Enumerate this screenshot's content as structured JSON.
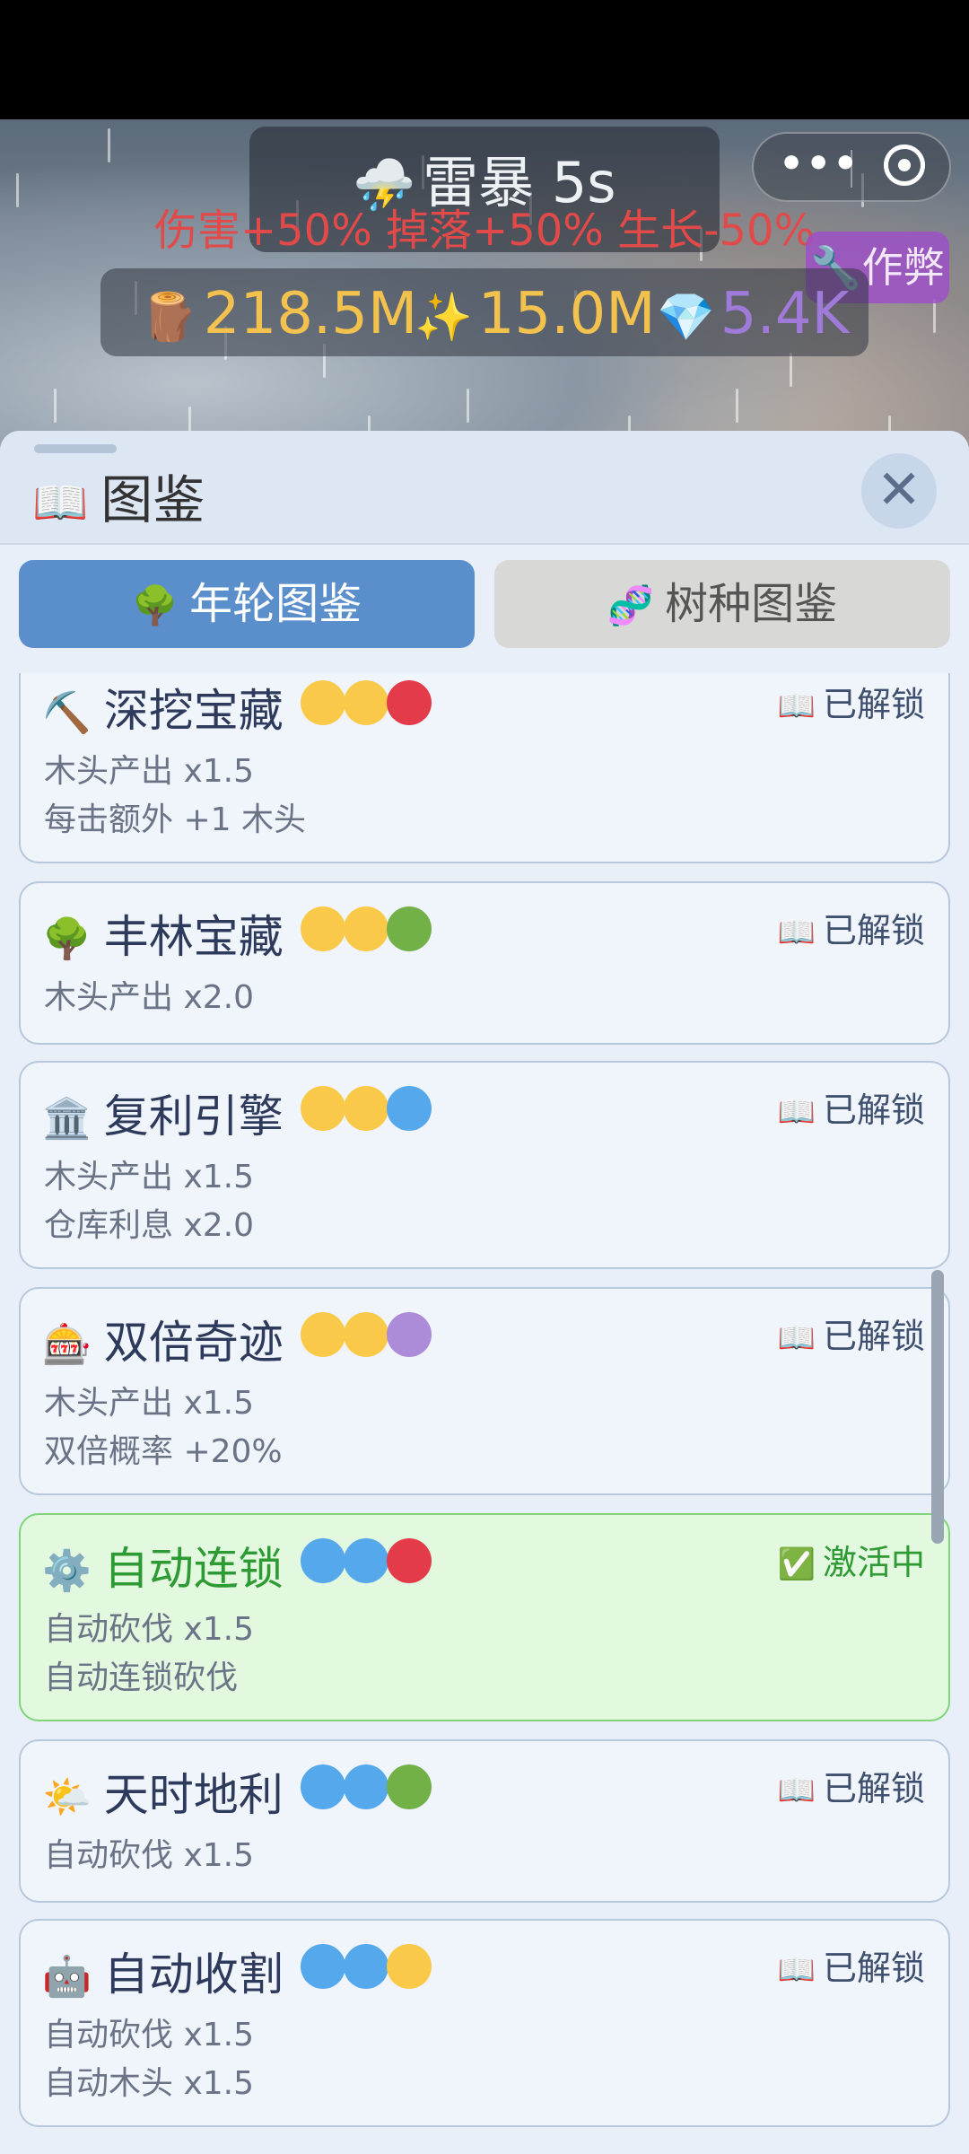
{
  "weather": {
    "icon": "thunderstorm-cloud-icon",
    "title": "雷暴 5s",
    "effect": "伤害+50% 掉落+50% 生长-50%"
  },
  "resources": {
    "wood": {
      "icon": "wood-log-icon",
      "value": "218.5M"
    },
    "sparkle": {
      "icon": "sparkle-icon",
      "value": "15.0M"
    },
    "gem": {
      "icon": "gem-icon",
      "value": "5.4K"
    }
  },
  "cheat_button": {
    "label": "作弊",
    "icon": "wrench-icon"
  },
  "panel": {
    "title": "图鉴",
    "title_icon": "book-icon",
    "tabs": [
      {
        "label": "年轮图鉴",
        "icon": "tree-icon",
        "active": true
      },
      {
        "label": "树种图鉴",
        "icon": "dna-icon",
        "active": false
      }
    ]
  },
  "colors": {
    "yellow": "#fbc94a",
    "red": "#e43b4a",
    "green": "#72b048",
    "blue": "#55a8ec",
    "purple": "#ac8bd8"
  },
  "cards": [
    {
      "icon_char": "⛏️",
      "icon": "pickaxe-icon",
      "name": "深挖宝藏",
      "balls": [
        "yellow",
        "yellow",
        "red"
      ],
      "status": "已解锁",
      "status_icon": "book-icon",
      "active": false,
      "effects": [
        "木头产出 x1.5",
        "每击额外 +1 木头"
      ]
    },
    {
      "icon_char": "🌳",
      "icon": "tree-icon",
      "name": "丰林宝藏",
      "balls": [
        "yellow",
        "yellow",
        "green"
      ],
      "status": "已解锁",
      "status_icon": "book-icon",
      "active": false,
      "effects": [
        "木头产出 x2.0"
      ]
    },
    {
      "icon_char": "🏛️",
      "icon": "bank-icon",
      "name": "复利引擎",
      "balls": [
        "yellow",
        "yellow",
        "blue"
      ],
      "status": "已解锁",
      "status_icon": "book-icon",
      "active": false,
      "effects": [
        "木头产出 x1.5",
        "仓库利息 x2.0"
      ]
    },
    {
      "icon_char": "🎰",
      "icon": "slot-machine-icon",
      "name": "双倍奇迹",
      "balls": [
        "yellow",
        "yellow",
        "purple"
      ],
      "status": "已解锁",
      "status_icon": "book-icon",
      "active": false,
      "effects": [
        "木头产出 x1.5",
        "双倍概率 +20%"
      ]
    },
    {
      "icon_char": "⚙️",
      "icon": "gear-icon",
      "name": "自动连锁",
      "balls": [
        "blue",
        "blue",
        "red"
      ],
      "status": "激活中",
      "status_icon": "check-box-icon",
      "active": true,
      "effects": [
        "自动砍伐 x1.5",
        "自动连锁砍伐"
      ]
    },
    {
      "icon_char": "🌤️",
      "icon": "sun-cloud-icon",
      "name": "天时地利",
      "balls": [
        "blue",
        "blue",
        "green"
      ],
      "status": "已解锁",
      "status_icon": "book-icon",
      "active": false,
      "effects": [
        "自动砍伐 x1.5"
      ]
    },
    {
      "icon_char": "🤖",
      "icon": "robot-icon",
      "name": "自动收割",
      "balls": [
        "blue",
        "blue",
        "yellow"
      ],
      "status": "已解锁",
      "status_icon": "book-icon",
      "active": false,
      "effects": [
        "自动砍伐 x1.5",
        "自动木头 x1.5"
      ]
    }
  ]
}
